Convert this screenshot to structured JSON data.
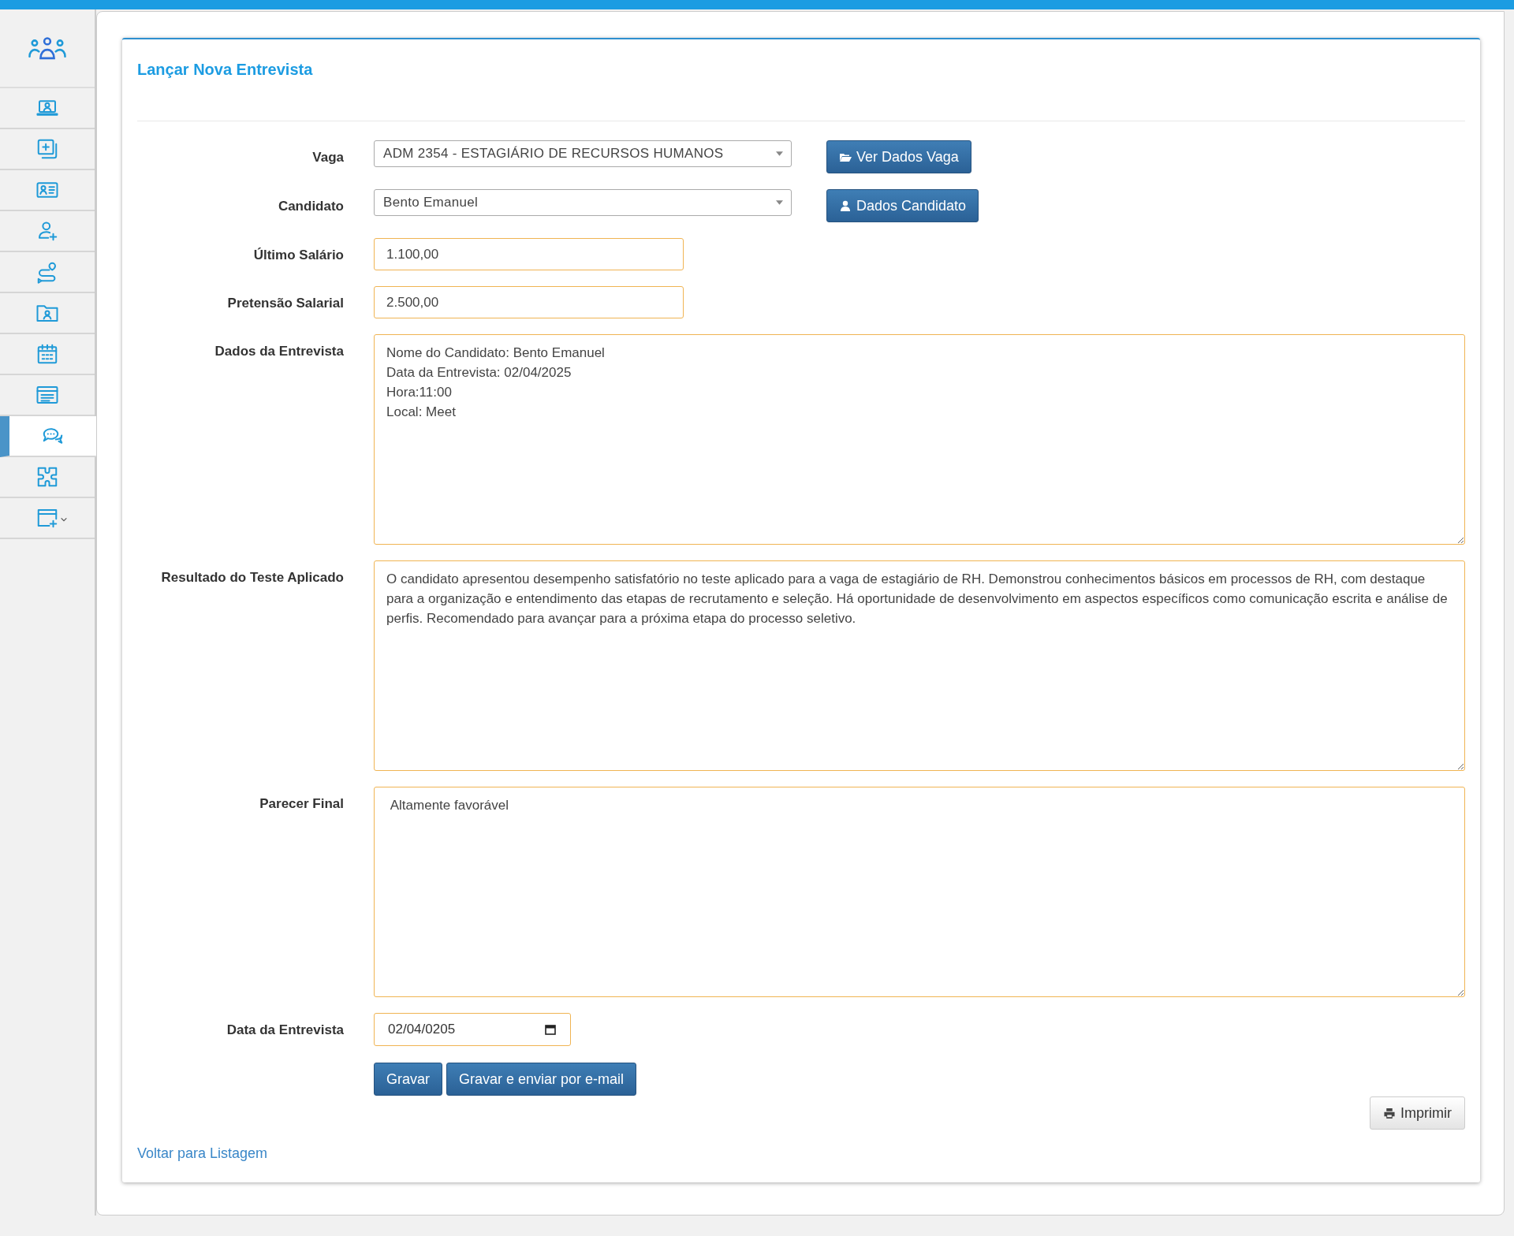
{
  "sidebar": {
    "items": [
      {
        "kind": "laptop-user",
        "selected": false
      },
      {
        "kind": "add-copy",
        "selected": false
      },
      {
        "kind": "id-card",
        "selected": false
      },
      {
        "kind": "user-add",
        "selected": false
      },
      {
        "kind": "route",
        "selected": false
      },
      {
        "kind": "folder-user",
        "selected": false
      },
      {
        "kind": "calendar",
        "selected": false
      },
      {
        "kind": "list-window",
        "selected": false
      },
      {
        "kind": "chat",
        "selected": true
      },
      {
        "kind": "puzzle",
        "selected": false
      },
      {
        "kind": "add-window-menu",
        "selected": false
      }
    ]
  },
  "form": {
    "title": "Lançar Nova Entrevista",
    "rows": [
      {
        "kind": "select",
        "label": "Vaga",
        "value": "ADM 2354 - ESTAGIÁRIO DE RECURSOS HUMANOS",
        "button": {
          "kind": "folder",
          "label": "Ver Dados Vaga"
        }
      },
      {
        "kind": "select",
        "label": "Candidato",
        "value": "Bento Emanuel",
        "button": {
          "kind": "user",
          "label": "Dados Candidato"
        }
      },
      {
        "kind": "input",
        "label": "Último Salário",
        "value": "1.100,00"
      },
      {
        "kind": "input",
        "label": "Pretensão Salarial",
        "value": "2.500,00"
      },
      {
        "kind": "textarea",
        "label": "Dados da Entrevista",
        "value": "Nome do Candidato: Bento Emanuel\nData da Entrevista: 02/04/2025\nHora:11:00\nLocal: Meet"
      },
      {
        "kind": "textarea",
        "label": "Resultado do Teste Aplicado",
        "value": "O candidato apresentou desempenho satisfatório no teste aplicado para a vaga de estagiário de RH. Demonstrou conhecimentos básicos em processos de RH, com destaque para a organização e entendimento das etapas de recrutamento e seleção. Há oportunidade de desenvolvimento em aspectos específicos como comunicação escrita e análise de perfis. Recomendado para avançar para a próxima etapa do processo seletivo."
      },
      {
        "kind": "textarea",
        "label": "Parecer Final",
        "value": " Altamente favorável"
      },
      {
        "kind": "date",
        "label": "Data da Entrevista",
        "value": "02/04/0205"
      }
    ],
    "actions": [
      "Gravar",
      "Gravar e enviar por e-mail"
    ],
    "print_button": "Imprimir",
    "back_link": "Voltar para Listagem"
  }
}
